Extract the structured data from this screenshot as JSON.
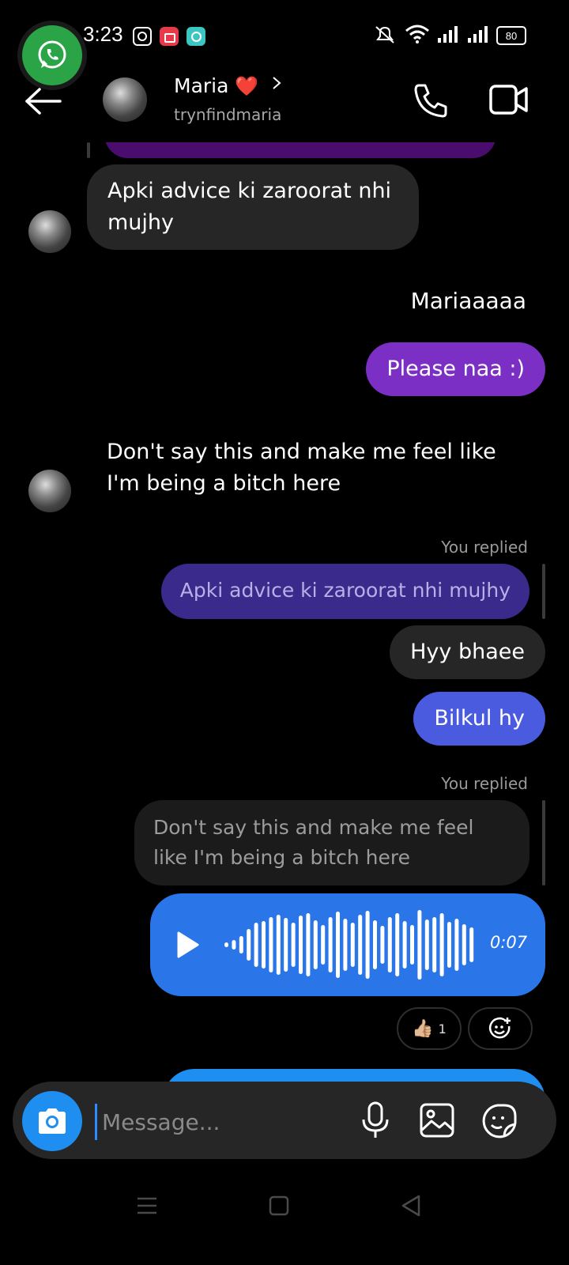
{
  "status_bar": {
    "time": "3:23",
    "battery": "80"
  },
  "header": {
    "name": "Maria",
    "heart": "❤️",
    "username": "trynfindmaria"
  },
  "messages": {
    "m1": {
      "text": "Apki advice ki zaroorat nhi mujhy"
    },
    "m2": {
      "text": "Mariaaaaa"
    },
    "m3": {
      "text": "Please naa :)"
    },
    "m4": {
      "text": "Don't say this and make me feel like I'm being a bitch here"
    },
    "reply1": {
      "label": "You replied",
      "quoted": "Apki advice ki zaroorat nhi mujhy"
    },
    "m5": {
      "text": "Hyy bhaee"
    },
    "m6": {
      "text": "Bilkul hy"
    },
    "reply2": {
      "label": "You replied",
      "quoted": "Don't say this and make me feel like I'm being a bitch here"
    },
    "voice": {
      "duration": "0:07"
    },
    "reaction": {
      "emoji": "👍🏼",
      "count": "1"
    }
  },
  "composer": {
    "placeholder": "Message..."
  },
  "colors": {
    "accent_blue": "#2a76e8",
    "purple": "#7b2fc4",
    "indigo": "#5b4bdc",
    "incoming": "#262626",
    "whatsapp": "#2aa447"
  },
  "icons": [
    "whatsapp-icon",
    "instagram-icon",
    "screen-record-icon",
    "app-icon",
    "mute-icon",
    "wifi-icon",
    "signal-icon",
    "back-arrow-icon",
    "chevron-right-icon",
    "phone-icon",
    "video-icon",
    "play-icon",
    "add-reaction-icon",
    "camera-icon",
    "mic-icon",
    "gallery-icon",
    "sticker-icon",
    "menu-icon",
    "home-icon",
    "back-icon"
  ]
}
